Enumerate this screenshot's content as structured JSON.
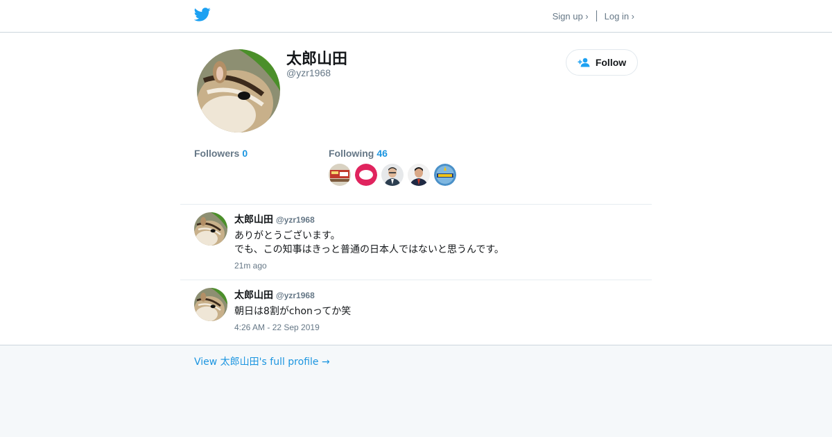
{
  "header": {
    "signup_label": "Sign up ›",
    "login_label": "Log in ›"
  },
  "profile": {
    "name": "太郎山田",
    "handle": "@yzr1968",
    "follow_label": "Follow",
    "followers_label": "Followers",
    "followers_count": "0",
    "following_label": "Following",
    "following_count": "46"
  },
  "tweets": [
    {
      "name": "太郎山田",
      "handle": "@yzr1968",
      "line1": "ありがとうございます。",
      "line2": "でも、この知事はきっと普通の日本人ではないと思うんです。",
      "time": "21m ago"
    },
    {
      "name": "太郎山田",
      "handle": "@yzr1968",
      "line1": "朝日は8割がchonってか笑",
      "time": "4:26 AM - 22 Sep 2019"
    }
  ],
  "footer": {
    "link_label": "View 太郎山田's full profile →"
  },
  "colors": {
    "accent": "#1b95e0",
    "twitter_blue": "#1da1f2",
    "muted": "#657786",
    "footer_bg": "#f5f8fa"
  }
}
